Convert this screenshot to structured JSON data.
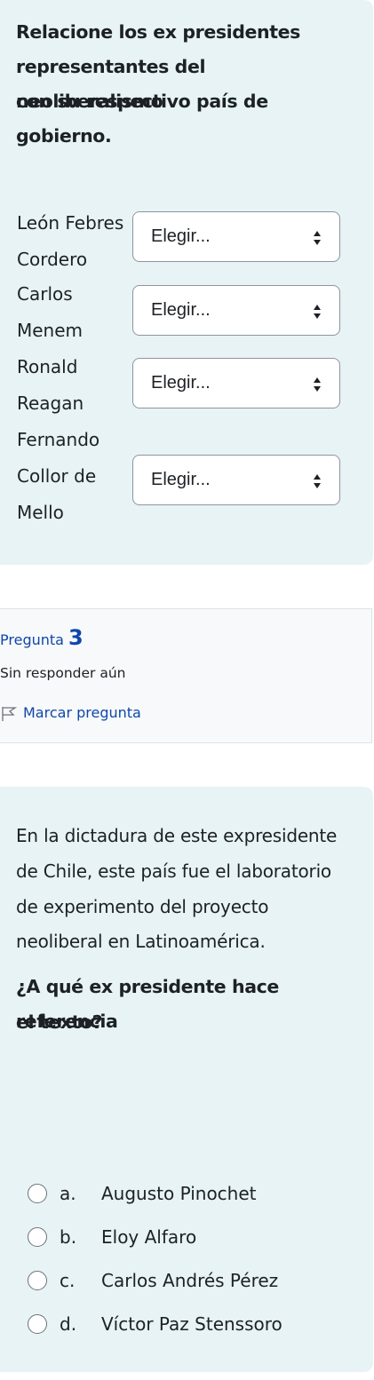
{
  "question2": {
    "prompt": [
      "Relacione los ex presidentes",
      "representantes del  neoliberalismo",
      "con su respectivo país de gobierno."
    ],
    "rows": [
      {
        "label": [
          "León Febres",
          "Cordero"
        ],
        "select_value": "Elegir..."
      },
      {
        "label": [
          "Carlos",
          "Menem"
        ],
        "select_value": "Elegir..."
      },
      {
        "label": [
          "Ronald",
          "Reagan"
        ],
        "select_value": "Elegir..."
      },
      {
        "label": [
          "Fernando",
          "Collor de",
          "Mello"
        ],
        "select_value": "Elegir..."
      }
    ]
  },
  "question3": {
    "info": {
      "prefix": "Pregunta",
      "number": "3",
      "state": "Sin responder aún",
      "flag_label": "Marcar pregunta"
    },
    "text": [
      "En la dictadura de este expresidente",
      "de Chile, este país fue el laboratorio",
      "de experimento del proyecto",
      "neoliberal en Latinoamérica."
    ],
    "prompt": [
      "¿A qué ex presidente hace referencia",
      "el texto?"
    ],
    "options": [
      {
        "letter": "a.",
        "label": "Augusto Pinochet"
      },
      {
        "letter": "b.",
        "label": "Eloy Alfaro"
      },
      {
        "letter": "c.",
        "label": "Carlos Andrés Pérez"
      },
      {
        "letter": "d.",
        "label": "Víctor Paz Stenssoro"
      }
    ]
  },
  "colors": {
    "card_bg": "#e7f3f5",
    "link": "#0f47ad",
    "info_bg": "#f8f9fa"
  }
}
